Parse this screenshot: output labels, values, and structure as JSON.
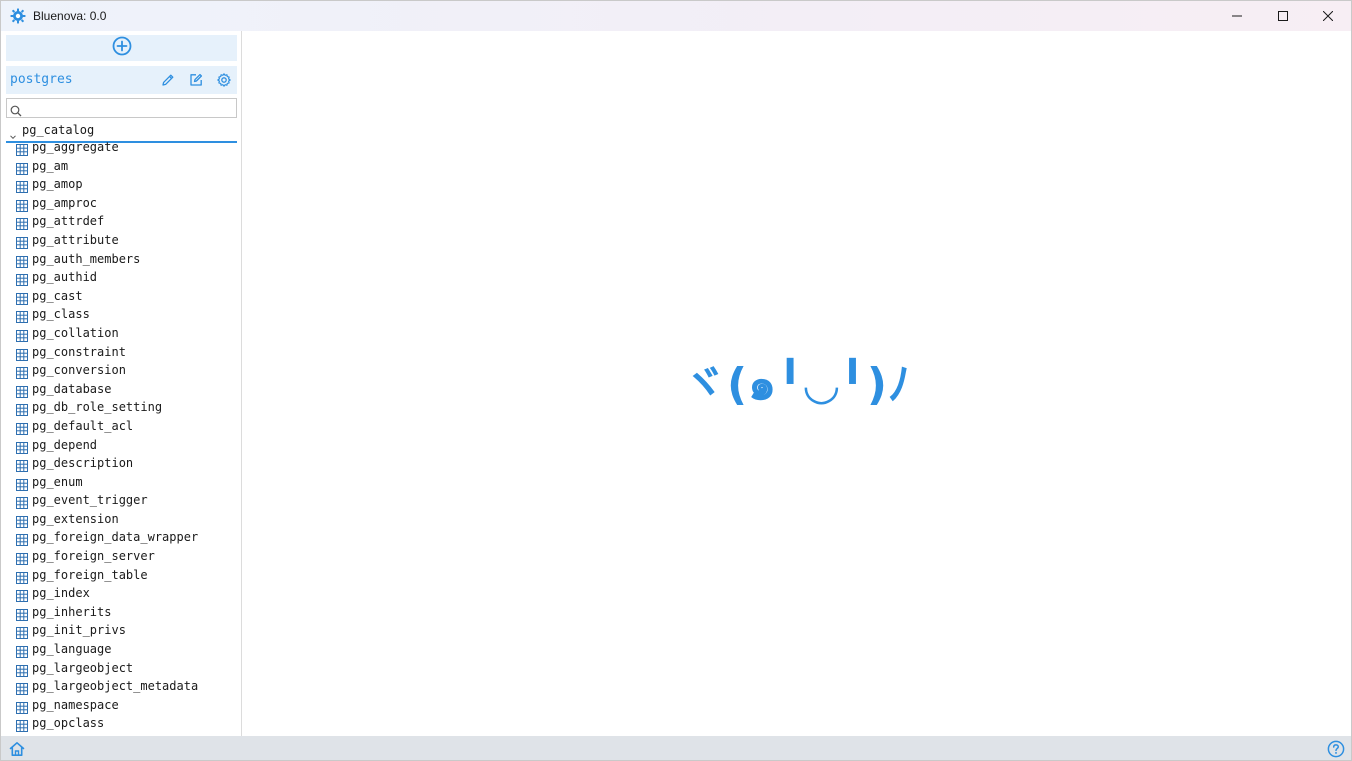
{
  "window": {
    "title": "Bluenova: 0.0"
  },
  "colors": {
    "accent": "#2e8fe0",
    "panel_highlight": "#e6f1fb",
    "footer_bg": "#dfe3e8",
    "text": "#1a1a1a"
  },
  "icons": {
    "app": "bluenova-gear-icon",
    "minimize": "minimize-icon",
    "maximize": "maximize-icon",
    "close": "close-icon",
    "add_connection": "plus-circle-icon",
    "edit": "pencil-icon",
    "edit_query": "edit-square-icon",
    "settings": "gear-icon",
    "search": "search-icon",
    "expand": "chevron-down-icon",
    "table": "table-grid-icon",
    "home": "home-icon",
    "help": "help-icon"
  },
  "sidebar": {
    "connection": {
      "name": "postgres"
    },
    "search": {
      "value": "",
      "placeholder": ""
    },
    "schema": {
      "name": "pg_catalog",
      "expanded": true,
      "tables": [
        "pg_aggregate",
        "pg_am",
        "pg_amop",
        "pg_amproc",
        "pg_attrdef",
        "pg_attribute",
        "pg_auth_members",
        "pg_authid",
        "pg_cast",
        "pg_class",
        "pg_collation",
        "pg_constraint",
        "pg_conversion",
        "pg_database",
        "pg_db_role_setting",
        "pg_default_acl",
        "pg_depend",
        "pg_description",
        "pg_enum",
        "pg_event_trigger",
        "pg_extension",
        "pg_foreign_data_wrapper",
        "pg_foreign_server",
        "pg_foreign_table",
        "pg_index",
        "pg_inherits",
        "pg_init_privs",
        "pg_language",
        "pg_largeobject",
        "pg_largeobject_metadata",
        "pg_namespace",
        "pg_opclass"
      ]
    }
  },
  "main": {
    "placeholder_text": "ヾ(๑╹◡╹)ﾉ"
  }
}
